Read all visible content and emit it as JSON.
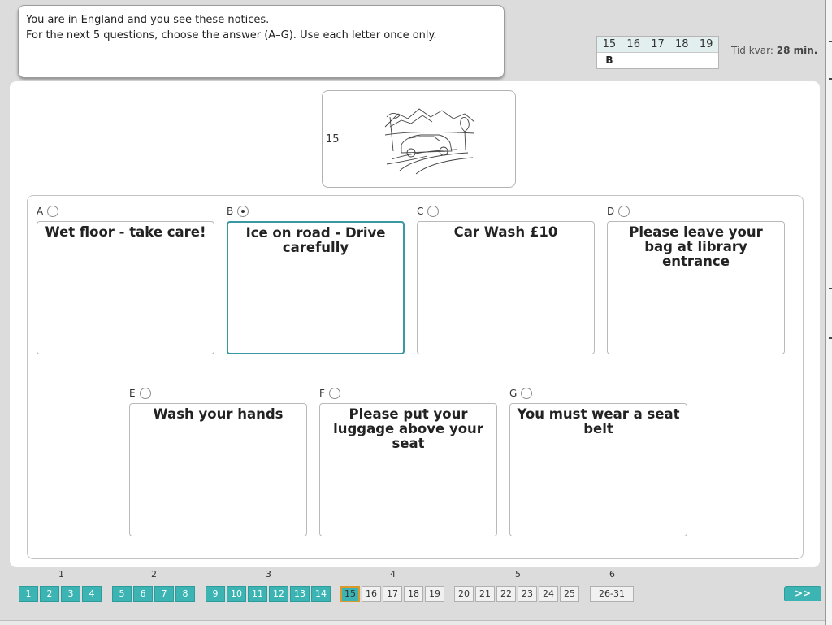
{
  "instructions": {
    "line1": "You are in England and you see these notices.",
    "line2": "For the next 5 questions, choose the answer (A–G). Use each letter once only."
  },
  "summary": {
    "questions": [
      "15",
      "16",
      "17",
      "18",
      "19"
    ],
    "answers": [
      "B",
      "",
      "",
      "",
      ""
    ]
  },
  "timer": {
    "label": "Tid kvar:",
    "value": "28 min."
  },
  "question": {
    "number": "15",
    "picture_icon": "icy-road-car-illustration"
  },
  "options": [
    {
      "letter": "A",
      "text": "Wet floor - take care!",
      "selected": false
    },
    {
      "letter": "B",
      "text": "Ice on road - Drive carefully",
      "selected": true
    },
    {
      "letter": "C",
      "text": "Car Wash £10",
      "selected": false
    },
    {
      "letter": "D",
      "text": "Please leave your bag at library entrance",
      "selected": false
    },
    {
      "letter": "E",
      "text": "Wash your hands",
      "selected": false
    },
    {
      "letter": "F",
      "text": "Please put your luggage above your seat",
      "selected": false
    },
    {
      "letter": "G",
      "text": "You must wear a seat belt",
      "selected": false
    }
  ],
  "navigation": {
    "groups": [
      "1",
      "2",
      "3",
      "4",
      "5",
      "6"
    ],
    "pages": [
      {
        "label": "1",
        "state": "done"
      },
      {
        "label": "2",
        "state": "done"
      },
      {
        "label": "3",
        "state": "done"
      },
      {
        "label": "4",
        "state": "done"
      },
      {
        "label": "5",
        "state": "done"
      },
      {
        "label": "6",
        "state": "done"
      },
      {
        "label": "7",
        "state": "done"
      },
      {
        "label": "8",
        "state": "done"
      },
      {
        "label": "9",
        "state": "done"
      },
      {
        "label": "10",
        "state": "done"
      },
      {
        "label": "11",
        "state": "done"
      },
      {
        "label": "12",
        "state": "done"
      },
      {
        "label": "13",
        "state": "done"
      },
      {
        "label": "14",
        "state": "done"
      },
      {
        "label": "15",
        "state": "current"
      },
      {
        "label": "16",
        "state": "todo"
      },
      {
        "label": "17",
        "state": "todo"
      },
      {
        "label": "18",
        "state": "todo"
      },
      {
        "label": "19",
        "state": "todo"
      },
      {
        "label": "20",
        "state": "todo"
      },
      {
        "label": "21",
        "state": "todo"
      },
      {
        "label": "22",
        "state": "todo"
      },
      {
        "label": "23",
        "state": "todo"
      },
      {
        "label": "24",
        "state": "todo"
      },
      {
        "label": "25",
        "state": "todo"
      },
      {
        "label": "26-31",
        "state": "todo"
      }
    ],
    "next_label": ">>"
  },
  "colors": {
    "accent": "#3cb4b3",
    "selected_border": "#3a98a1",
    "current_outline": "#d99a2b"
  }
}
